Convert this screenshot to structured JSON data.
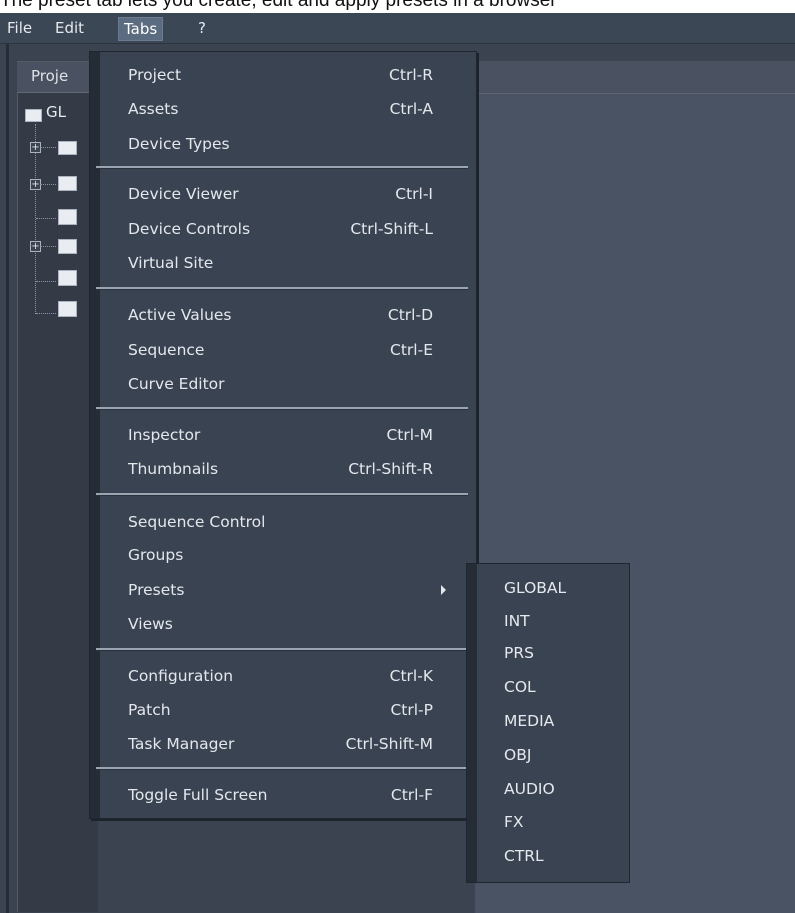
{
  "caption": "The preset tab lets you create, edit and apply presets in a browser",
  "menubar": {
    "items": [
      {
        "label": "File"
      },
      {
        "label": "Edit"
      },
      {
        "label": "Tabs"
      },
      {
        "label": "?"
      }
    ]
  },
  "project_panel": {
    "tab_label": "Proje",
    "root_label": "GL"
  },
  "tabs_menu": {
    "groups": [
      [
        {
          "label": "Project",
          "shortcut": "Ctrl-R"
        },
        {
          "label": "Assets",
          "shortcut": "Ctrl-A"
        },
        {
          "label": "Device Types",
          "shortcut": ""
        }
      ],
      [
        {
          "label": "Device Viewer",
          "shortcut": "Ctrl-I"
        },
        {
          "label": "Device Controls",
          "shortcut": "Ctrl-Shift-L"
        },
        {
          "label": "Virtual Site",
          "shortcut": ""
        }
      ],
      [
        {
          "label": "Active Values",
          "shortcut": "Ctrl-D"
        },
        {
          "label": "Sequence",
          "shortcut": "Ctrl-E"
        },
        {
          "label": "Curve Editor",
          "shortcut": ""
        }
      ],
      [
        {
          "label": "Inspector",
          "shortcut": "Ctrl-M"
        },
        {
          "label": "Thumbnails",
          "shortcut": "Ctrl-Shift-R"
        }
      ],
      [
        {
          "label": "Sequence Control",
          "shortcut": ""
        },
        {
          "label": "Groups",
          "shortcut": ""
        },
        {
          "label": "Presets",
          "shortcut": "",
          "submenu": true
        },
        {
          "label": "Views",
          "shortcut": ""
        }
      ],
      [
        {
          "label": "Configuration",
          "shortcut": "Ctrl-K"
        },
        {
          "label": "Patch",
          "shortcut": "Ctrl-P"
        },
        {
          "label": "Task Manager",
          "shortcut": "Ctrl-Shift-M"
        }
      ],
      [
        {
          "label": "Toggle Full Screen",
          "shortcut": "Ctrl-F"
        }
      ]
    ]
  },
  "presets_submenu": {
    "items": [
      "GLOBAL",
      "INT",
      "PRS",
      "COL",
      "MEDIA",
      "OBJ",
      "AUDIO",
      "FX",
      "CTRL"
    ]
  }
}
